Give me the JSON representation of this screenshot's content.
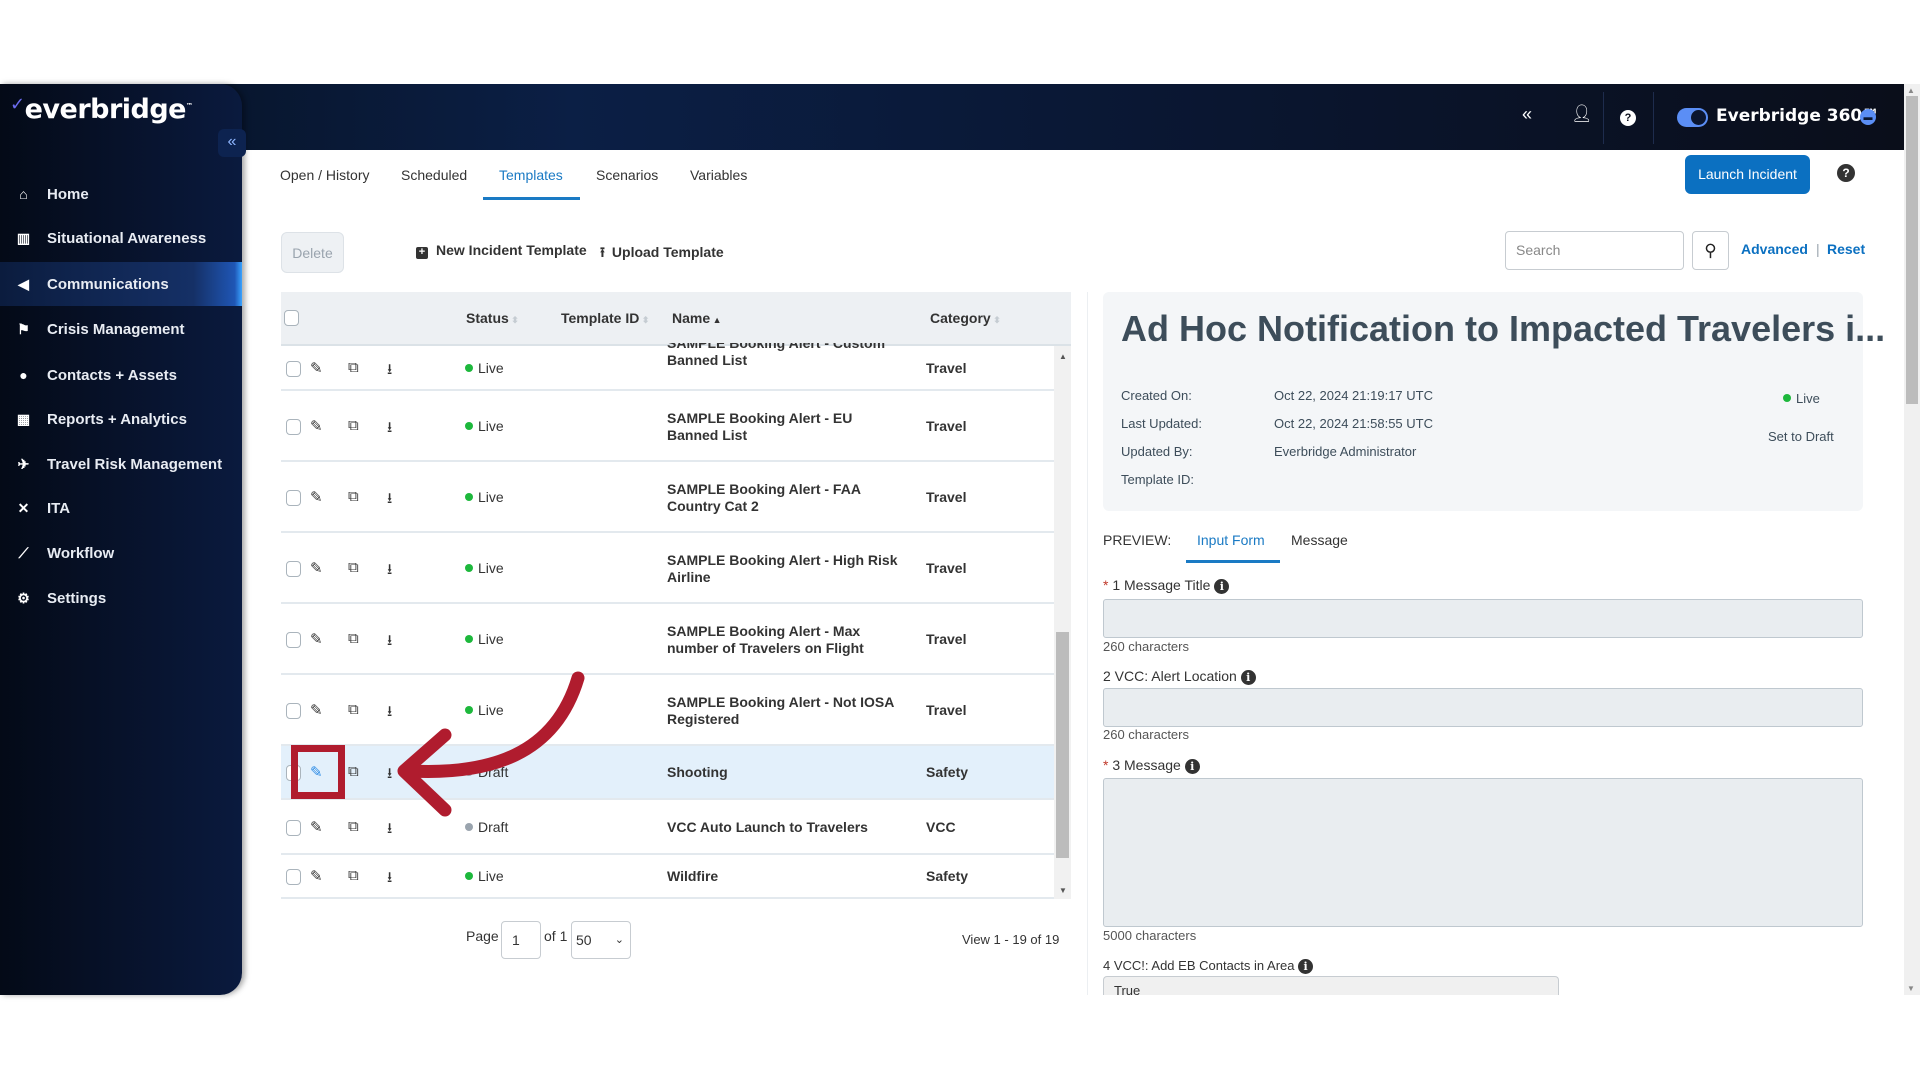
{
  "brand": {
    "logo": "everbridge",
    "tm": "™",
    "product": "Everbridge 360™"
  },
  "header": {
    "icons": [
      "double-chevron-left-icon",
      "user-icon",
      "help-icon",
      "chat-icon"
    ]
  },
  "sidebar": {
    "collapse": "«",
    "items": [
      {
        "label": "Home",
        "icon": "home-icon",
        "glyph": "⌂"
      },
      {
        "label": "Situational Awareness",
        "icon": "map-icon",
        "glyph": "▥"
      },
      {
        "label": "Communications",
        "icon": "megaphone-icon",
        "glyph": "◀",
        "active": true
      },
      {
        "label": "Crisis Management",
        "icon": "crisis-icon",
        "glyph": "⚑"
      },
      {
        "label": "Contacts + Assets",
        "icon": "location-pin-icon",
        "glyph": "●"
      },
      {
        "label": "Reports + Analytics",
        "icon": "bar-chart-icon",
        "glyph": "▦"
      },
      {
        "label": "Travel Risk Management",
        "icon": "plane-icon",
        "glyph": "✈"
      },
      {
        "label": "ITA",
        "icon": "network-icon",
        "glyph": "✕"
      },
      {
        "label": "Workflow",
        "icon": "line-chart-icon",
        "glyph": "⟋"
      },
      {
        "label": "Settings",
        "icon": "gear-icon",
        "glyph": "⚙"
      }
    ]
  },
  "tabs": [
    {
      "label": "Open / History"
    },
    {
      "label": "Scheduled"
    },
    {
      "label": "Templates",
      "active": true
    },
    {
      "label": "Scenarios"
    },
    {
      "label": "Variables"
    }
  ],
  "actions": {
    "launch": "Launch Incident",
    "delete": "Delete",
    "new_template": "New Incident Template",
    "upload": "Upload Template",
    "search_placeholder": "Search",
    "advanced": "Advanced",
    "sep": "|",
    "reset": "Reset"
  },
  "table": {
    "columns": [
      "Status",
      "Template ID",
      "Name",
      "Category"
    ],
    "sorted_column": "Name",
    "rows": [
      {
        "status": "Live",
        "template_id": "",
        "name": "SAMPLE Booking Alert - Custom Banned List",
        "category": "Travel"
      },
      {
        "status": "Live",
        "template_id": "",
        "name": "SAMPLE Booking Alert - EU Banned List",
        "category": "Travel"
      },
      {
        "status": "Live",
        "template_id": "",
        "name": "SAMPLE Booking Alert - FAA Country Cat 2",
        "category": "Travel"
      },
      {
        "status": "Live",
        "template_id": "",
        "name": "SAMPLE Booking Alert - High Risk Airline",
        "category": "Travel"
      },
      {
        "status": "Live",
        "template_id": "",
        "name": "SAMPLE Booking Alert - Max number of Travelers on Flight",
        "category": "Travel"
      },
      {
        "status": "Live",
        "template_id": "",
        "name": "SAMPLE Booking Alert - Not IOSA Registered",
        "category": "Travel"
      },
      {
        "status": "Draft",
        "template_id": "",
        "name": "Shooting",
        "category": "Safety",
        "highlighted": true
      },
      {
        "status": "Draft",
        "template_id": "",
        "name": "VCC Auto Launch to Travelers",
        "category": "VCC"
      },
      {
        "status": "Live",
        "template_id": "",
        "name": "Wildfire",
        "category": "Safety"
      }
    ],
    "pagination": {
      "page_label": "Page",
      "page": "1",
      "of_label": "of 1",
      "page_size": "50",
      "view": "View 1 - 19 of 19"
    }
  },
  "detail": {
    "title": "Ad Hoc Notification to Impacted Travelers i...",
    "fields": [
      {
        "label": "Created On:",
        "value": "Oct 22, 2024 21:19:17 UTC"
      },
      {
        "label": "Last Updated:",
        "value": "Oct 22, 2024 21:58:55 UTC"
      },
      {
        "label": "Updated By:",
        "value": "Everbridge Administrator"
      },
      {
        "label": "Template ID:",
        "value": ""
      }
    ],
    "status": "Live",
    "set_draft": "Set to Draft"
  },
  "preview": {
    "label": "PREVIEW:",
    "tabs": [
      {
        "label": "Input Form",
        "active": true
      },
      {
        "label": "Message"
      }
    ],
    "form": [
      {
        "required": true,
        "label": "1 Message Title",
        "note": "260 characters"
      },
      {
        "required": false,
        "label": "2 VCC: Alert Location",
        "note": "260 characters"
      },
      {
        "required": true,
        "label": "3 Message",
        "note": "5000 characters"
      },
      {
        "required": false,
        "label": "4 VCC!: Add EB Contacts in Area",
        "value": "True"
      }
    ]
  },
  "colors": {
    "accent": "#0b70c1",
    "live": "#1db83c",
    "draft": "#9aa4ae",
    "annotation": "#b01c2e"
  }
}
